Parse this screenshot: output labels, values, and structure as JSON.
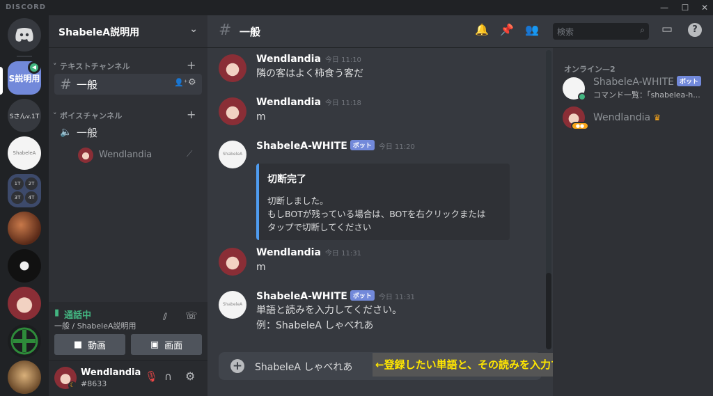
{
  "app": {
    "wordmark": "DISCORD",
    "window_controls": [
      "—",
      "☐",
      "✕"
    ]
  },
  "servers": [
    {
      "name": "home",
      "type": "discord-home"
    },
    {
      "name": "説明用",
      "label": "S説明用",
      "active": true
    },
    {
      "name": "Sさんv.1T",
      "label": "Sさんv.1T"
    },
    {
      "name": "shabelea-server",
      "label": "ShabeleA"
    },
    {
      "name": "folder",
      "labels": [
        "1T",
        "2T",
        "3T",
        "4T"
      ]
    },
    {
      "name": "server-creature"
    },
    {
      "name": "server-dark-face"
    },
    {
      "name": "server-wendlandia"
    },
    {
      "name": "server-green-emblem"
    },
    {
      "name": "server-dog"
    }
  ],
  "sidebar": {
    "guild_name": "ShabeleA説明用",
    "text_category": "テキストチャンネル",
    "voice_category": "ボイスチャンネル",
    "text_channels": [
      {
        "name": "一般",
        "active": true
      }
    ],
    "voice_channels": [
      {
        "name": "一般",
        "members": [
          "Wendlandia"
        ]
      }
    ]
  },
  "voice_status": {
    "state": "通話中",
    "location": "一般 / ShabeleA説明用",
    "video_label": "動画",
    "screen_label": "画面"
  },
  "user": {
    "name": "Wendlandia",
    "tag": "#8633"
  },
  "channel_header": {
    "name": "一般",
    "search_placeholder": "検索"
  },
  "messages": [
    {
      "author": "Wendlandia",
      "timestamp": "今日 11:10",
      "text": "隣の客はよく柿食う客だ",
      "bot": false
    },
    {
      "author": "Wendlandia",
      "timestamp": "今日 11:18",
      "text": "m",
      "bot": false
    },
    {
      "author": "ShabeleA-WHITE",
      "timestamp": "今日 11:20",
      "bot": true,
      "bot_badge": "ボット",
      "embed": {
        "title": "切断完了",
        "lines": [
          "切断しました。",
          "もしBOTが残っている場合は、BOTを右クリックまたは",
          "タップで切断してください"
        ],
        "color": "#4f9cf0"
      }
    },
    {
      "author": "Wendlandia",
      "timestamp": "今日 11:31",
      "text": "m",
      "bot": false
    },
    {
      "author": "ShabeleA-WHITE",
      "timestamp": "今日 11:31",
      "bot": true,
      "bot_badge": "ボット",
      "lines": [
        "単語と読みを入力してください。",
        "例：ShabeleA しゃべれあ"
      ]
    }
  ],
  "composer": {
    "text": "ShabeleA しゃべれあ"
  },
  "annotation": "←登録したい単語と、その読みを入力する",
  "members": {
    "header": "オンライン—2",
    "list": [
      {
        "name": "ShabeleA-WHITE",
        "badge": "ボット",
        "status": "コマンド一覧：「shabelea-h..."
      },
      {
        "name": "Wendlandia",
        "crown": "♛"
      }
    ]
  },
  "colors": {
    "accent": "#7289da",
    "online": "#43b581",
    "voice_green": "#43b581",
    "embed_bar": "#4f9cf0",
    "annotation_text": "#ffe600"
  }
}
